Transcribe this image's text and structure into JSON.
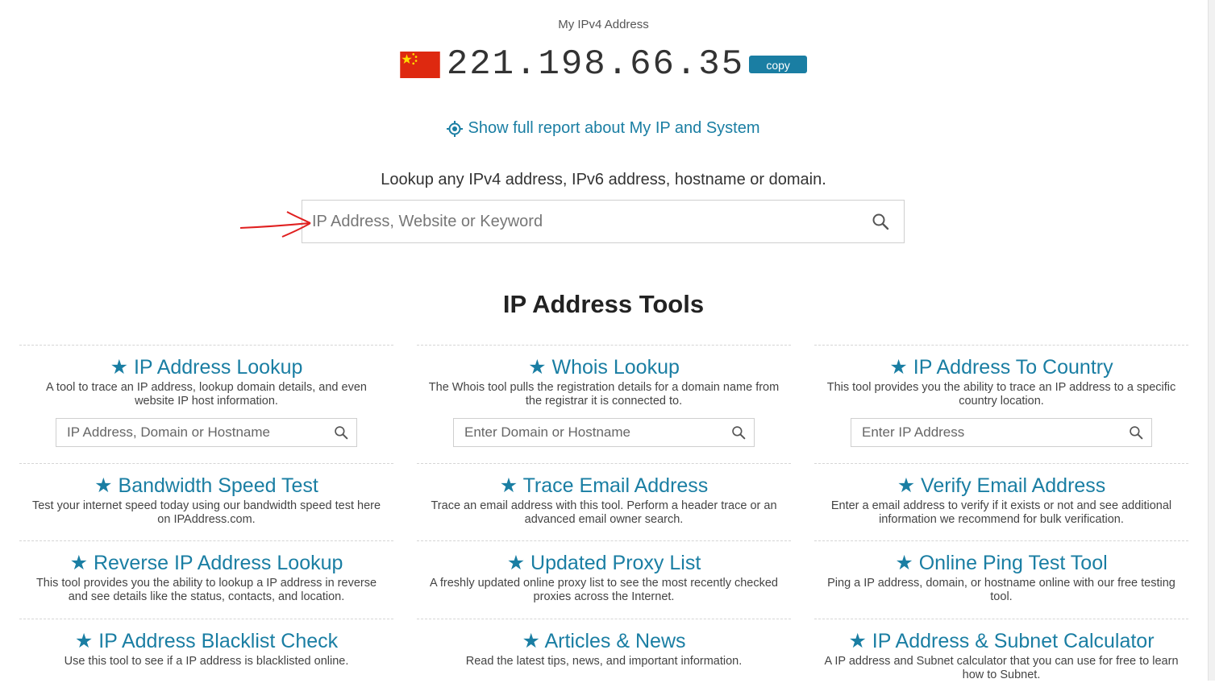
{
  "header": {
    "ip_caption": "My IPv4 Address",
    "ip_value": "221.198.66.35",
    "copy_label": "copy",
    "report_link": "Show full report about My IP and System"
  },
  "lookup": {
    "caption": "Lookup any IPv4 address, IPv6 address, hostname or domain.",
    "placeholder": "IP Address, Website or Keyword"
  },
  "tools": {
    "title": "IP Address Tools",
    "rows": [
      [
        {
          "title": "★ IP Address Lookup",
          "desc": "A tool to trace an IP address, lookup domain details, and even website IP host information.",
          "placeholder": "IP Address, Domain or Hostname"
        },
        {
          "title": "★ Whois Lookup",
          "desc": "The Whois tool pulls the registration details for a domain name from the registrar it is connected to.",
          "placeholder": "Enter Domain or Hostname"
        },
        {
          "title": "★ IP Address To Country",
          "desc": "This tool provides you the ability to trace an IP address to a specific country location.",
          "placeholder": "Enter IP Address"
        }
      ],
      [
        {
          "title": "★ Bandwidth Speed Test",
          "desc": "Test your internet speed today using our bandwidth speed test here on IPAddress.com."
        },
        {
          "title": "★ Trace Email Address",
          "desc": "Trace an email address with this tool. Perform a header trace or an advanced email owner search."
        },
        {
          "title": "★ Verify Email Address",
          "desc": "Enter a email address to verify if it exists or not and see additional information we recommend for bulk verification."
        }
      ],
      [
        {
          "title": "★ Reverse IP Address Lookup",
          "desc": "This tool provides you the ability to lookup a IP address in reverse and see details like the status, contacts, and location."
        },
        {
          "title": "★ Updated Proxy List",
          "desc": "A freshly updated online proxy list to see the most recently checked proxies across the Internet."
        },
        {
          "title": "★ Online Ping Test Tool",
          "desc": "Ping a IP address, domain, or hostname online with our free testing tool."
        }
      ],
      [
        {
          "title": "★ IP Address Blacklist Check",
          "desc": "Use this tool to see if a IP address is blacklisted online."
        },
        {
          "title": "★ Articles & News",
          "desc": "Read the latest tips, news, and important information."
        },
        {
          "title": "★ IP Address & Subnet Calculator",
          "desc": "A IP address and Subnet calculator that you can use for free to learn how to Subnet."
        }
      ]
    ]
  },
  "colors": {
    "accent": "#1a7ea3",
    "flag_red": "#de2910",
    "flag_yellow": "#ffde00",
    "annotation_arrow": "#e02020"
  },
  "icons": {
    "flag": "china-flag-icon",
    "report": "target-icon",
    "search": "search-icon",
    "arrow": "red-arrow-annotation"
  }
}
